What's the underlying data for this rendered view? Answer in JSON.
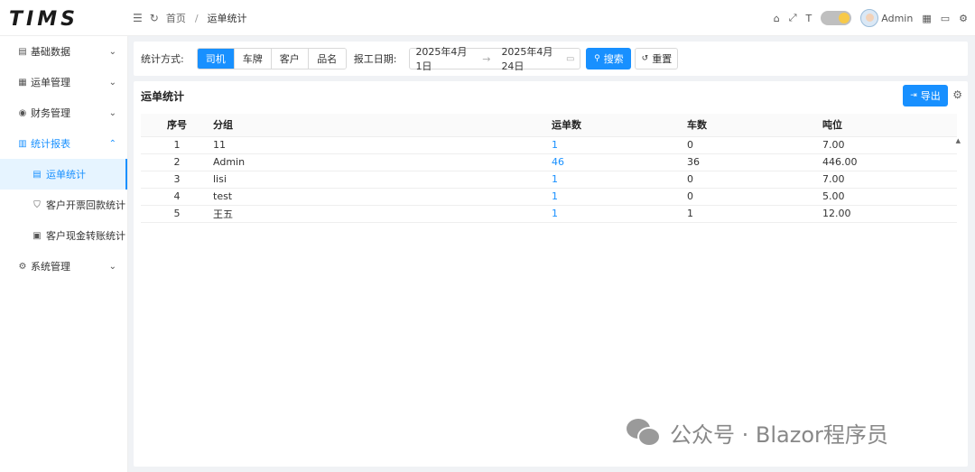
{
  "app": {
    "logo_text": "TIMS"
  },
  "topbar": {
    "breadcrumb": {
      "home": "首页",
      "separator": "/",
      "current": "运单统计"
    },
    "user": {
      "name": "Admin"
    }
  },
  "sidebar": {
    "items": [
      {
        "label": "基础数据",
        "icon": "list-icon"
      },
      {
        "label": "运单管理",
        "icon": "grid-icon"
      },
      {
        "label": "财务管理",
        "icon": "coin-icon"
      },
      {
        "label": "统计报表",
        "icon": "bar-chart-icon"
      },
      {
        "label": "系统管理",
        "icon": "gear-icon"
      }
    ],
    "sub_items": [
      {
        "label": "运单统计",
        "icon": "table-icon"
      },
      {
        "label": "客户开票回款统计",
        "icon": "shield-icon"
      },
      {
        "label": "客户现金转账统计",
        "icon": "clipboard-icon"
      }
    ]
  },
  "filter": {
    "mode_label": "统计方式:",
    "modes": [
      "司机",
      "车牌",
      "客户",
      "品名"
    ],
    "active_mode": "司机",
    "date_label": "报工日期:",
    "date_start": "2025年4月1日",
    "date_end": "2025年4月24日",
    "date_arrow": "→",
    "search_label": "搜索",
    "reset_label": "重置"
  },
  "main": {
    "title": "运单统计",
    "export_label": "导出",
    "table": {
      "headers": [
        "序号",
        "分组",
        "运单数",
        "车数",
        "吨位"
      ],
      "rows": [
        [
          "1",
          "11",
          "1",
          "0",
          "7.00"
        ],
        [
          "2",
          "Admin",
          "46",
          "36",
          "446.00"
        ],
        [
          "3",
          "lisi",
          "1",
          "0",
          "7.00"
        ],
        [
          "4",
          "test",
          "1",
          "0",
          "5.00"
        ],
        [
          "5",
          "王五",
          "1",
          "1",
          "12.00"
        ]
      ]
    }
  },
  "watermark": {
    "text": "公众号 · Blazor程序员"
  },
  "colors": {
    "primary": "#1890ff",
    "sidebar_active_bg": "#e6f4ff"
  }
}
